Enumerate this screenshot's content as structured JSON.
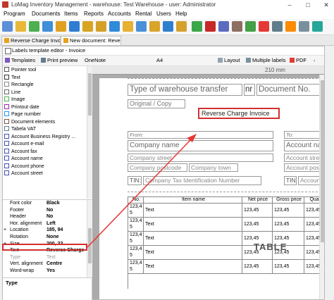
{
  "window": {
    "title": "LoMag Inventory Management - warehouse: Test Warehouse - user: Administrator",
    "minimize_label": "–",
    "maximize_label": "□",
    "close_label": "✕"
  },
  "menu": {
    "items": [
      "Program",
      "Documents",
      "Items",
      "Reports",
      "Accounts",
      "Rental",
      "Users",
      "Help"
    ]
  },
  "doc_tabs": [
    {
      "label": "Reverse Charge Invoic..."
    },
    {
      "label": "New document: Rever..."
    }
  ],
  "editor": {
    "title": "Labels template editor - Invoice",
    "toolbar": {
      "templates": "Templates",
      "print_preview": "Print preview",
      "font": "OneNote",
      "size": "A4",
      "layout": "Layout",
      "multiple_labels": "Multiple labels",
      "pdf": "PDF",
      "page_width": "210 mm"
    },
    "tools": [
      "Pointer tool",
      "Text",
      "Rectangle",
      "Line",
      "Image",
      "Printout date",
      "Page number",
      "Document elements",
      "Tabela VAT",
      "Account Business Registry ...",
      "Account e-mail",
      "Account fax",
      "Account name",
      "Account phone",
      "Account street"
    ],
    "properties": [
      {
        "key": "Font color",
        "value": "Black",
        "plus": ""
      },
      {
        "key": "Footer",
        "value": "No",
        "plus": ""
      },
      {
        "key": "Header",
        "value": "No",
        "plus": ""
      },
      {
        "key": "Hor. alignment",
        "value": "Left",
        "plus": ""
      },
      {
        "key": "Location",
        "value": "185, 94",
        "plus": "+"
      },
      {
        "key": "Rotation",
        "value": "None",
        "plus": ""
      },
      {
        "key": "Size",
        "value": "200, 22",
        "plus": "+"
      },
      {
        "key": "Text",
        "value": "Reverse Charge",
        "plus": ""
      },
      {
        "key": "Type",
        "value": "Text",
        "plus": ""
      },
      {
        "key": "Vert. alignment",
        "value": "Centre",
        "plus": ""
      },
      {
        "key": "Word-wrap",
        "value": "Yes",
        "plus": ""
      }
    ],
    "type_label": "Type"
  },
  "template": {
    "heading": "Type of warehouse transfer",
    "nr": "nr",
    "doc_no": "Document No.",
    "original": "Original / Copy",
    "reverse_charge": "Reverse Charge Invoice",
    "from": "From:",
    "to": "To:",
    "company_name": "Company name",
    "account_name": "Account name",
    "company_street": "Company street",
    "account_street": "Account street",
    "postcode": "Company postcode",
    "town": "Company town",
    "account_postcode": "Account postcode",
    "tin": "TIN:",
    "tin_value": "Company Tax Identification Number",
    "tin2": "TIN:",
    "account_tin": "Account",
    "table_watermark": "TABLE",
    "table_headers": [
      "No.",
      "Item name",
      "Net price",
      "Gross price",
      "Quantity"
    ],
    "table_rows": [
      [
        "123,4 5",
        "Text",
        "123,45",
        "123,45",
        "123,45"
      ],
      [
        "123,4 5",
        "Text",
        "123,45",
        "123,45",
        "123,45"
      ],
      [
        "123,4 5",
        "Text",
        "123,45",
        "123,45",
        "123,45"
      ],
      [
        "123,4 5",
        "Text",
        "123,45",
        "123,45",
        "123,45"
      ],
      [
        "123,4 5",
        "Text",
        "123,45",
        "123,45",
        "123,45"
      ]
    ]
  },
  "colors": {
    "highlight": "#d32f2f",
    "arrow": "#e53935"
  }
}
